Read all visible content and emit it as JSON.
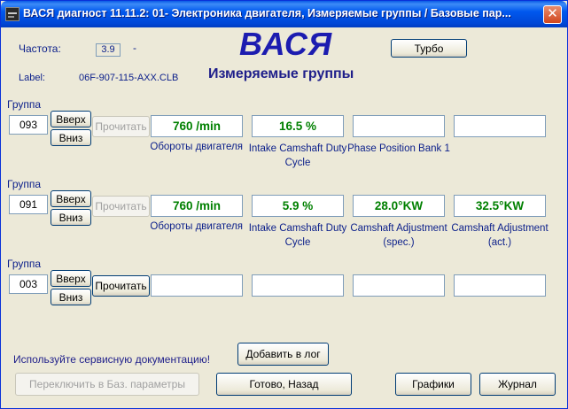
{
  "window": {
    "title": "ВАСЯ диагност 11.11.2: 01- Электроника двигателя,  Измеряемые группы / Базовые пар...",
    "close_glyph": "✕"
  },
  "header": {
    "freq_label": "Частота:",
    "freq_value": "3.9",
    "freq_dash": "-",
    "label_caption": "Label:",
    "label_value": "06F-907-115-AXX.CLB",
    "logo": "ВАСЯ",
    "heading": "Измеряемые группы",
    "turbo_button": "Турбо"
  },
  "groups": [
    {
      "label": "Группа",
      "number": "093",
      "up": "Вверх",
      "down": "Вниз",
      "read": "Прочитать",
      "read_enabled": false,
      "fields": [
        {
          "value": "760 /min",
          "desc": "Обороты двигателя"
        },
        {
          "value": "16.5 %",
          "desc": "Intake Camshaft Duty Cycle"
        },
        {
          "value": "",
          "desc": "Phase Position Bank 1"
        },
        {
          "value": "",
          "desc": ""
        }
      ]
    },
    {
      "label": "Группа",
      "number": "091",
      "up": "Вверх",
      "down": "Вниз",
      "read": "Прочитать",
      "read_enabled": false,
      "fields": [
        {
          "value": "760 /min",
          "desc": "Обороты двигателя"
        },
        {
          "value": "5.9 %",
          "desc": "Intake Camshaft Duty Cycle"
        },
        {
          "value": "28.0°KW",
          "desc": "Camshaft Adjustment (spec.)"
        },
        {
          "value": "32.5°KW",
          "desc": "Camshaft Adjustment (act.)"
        }
      ]
    },
    {
      "label": "Группа",
      "number": "003",
      "up": "Вверх",
      "down": "Вниз",
      "read": "Прочитать",
      "read_enabled": true,
      "fields": [
        {
          "value": "",
          "desc": ""
        },
        {
          "value": "",
          "desc": ""
        },
        {
          "value": "",
          "desc": ""
        },
        {
          "value": "",
          "desc": ""
        }
      ]
    }
  ],
  "footer": {
    "note": "Используйте сервисную документацию!",
    "add_log": "Добавить в лог",
    "switch_basic": "Переключить в Баз. параметры",
    "done_back": "Готово, Назад",
    "graphs": "Графики",
    "journal": "Журнал"
  },
  "colors": {
    "value_text": "#008000",
    "label_text": "#0a1e8a",
    "logo": "#1c1cb0",
    "titlebar": "#0058ee"
  }
}
